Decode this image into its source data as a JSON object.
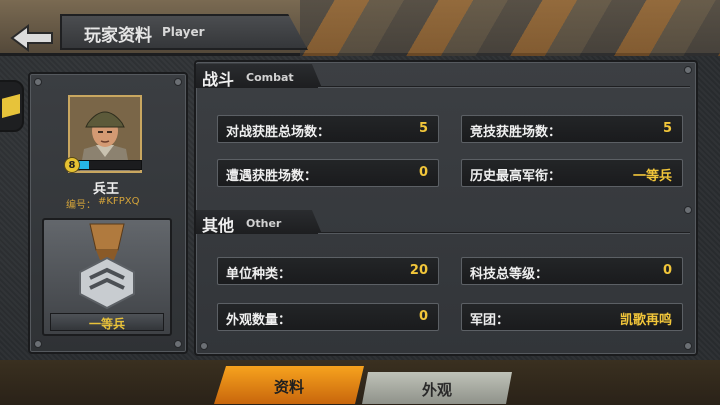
{
  "header": {
    "title_cn": "玩家资料",
    "title_en": "Player",
    "back_icon": "back-arrow-icon"
  },
  "profile": {
    "name": "兵王",
    "id_label": "编号：",
    "id_value": "#KFPXQ",
    "level": "8",
    "level_progress": 0.3,
    "rank": "一等兵"
  },
  "combat": {
    "title_cn": "战斗",
    "title_en": "Combat",
    "stats": [
      {
        "label": "对战获胜总场数：",
        "value": "5"
      },
      {
        "label": "竞技获胜场数：",
        "value": "5"
      },
      {
        "label": "遭遇获胜场数：",
        "value": "0"
      },
      {
        "label": "历史最高军衔：",
        "value": "一等兵"
      }
    ]
  },
  "other": {
    "title_cn": "其他",
    "title_en": "Other",
    "stats": [
      {
        "label": "单位种类：",
        "value": "20"
      },
      {
        "label": "科技总等级：",
        "value": "0"
      },
      {
        "label": "外观数量：",
        "value": "0"
      },
      {
        "label": "军团：",
        "value": "凯歌再鸣"
      }
    ]
  },
  "tabs": [
    {
      "label": "资料",
      "active": true
    },
    {
      "label": "外观",
      "active": false
    }
  ],
  "colors": {
    "accent": "#f2c63a",
    "tab_active": "#f7a31e",
    "level_bar": "#26b5e6"
  }
}
